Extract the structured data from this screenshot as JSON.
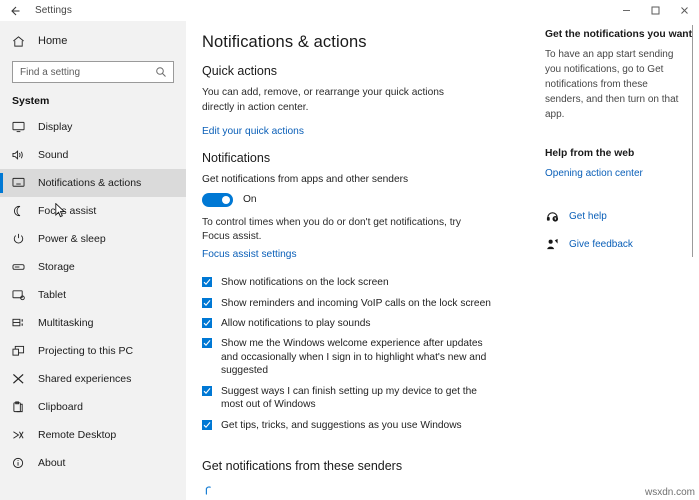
{
  "titlebar": {
    "back_label": "back-arrow",
    "title": "Settings",
    "minimize": "–",
    "maximize": "□",
    "close": "✕"
  },
  "sidebar": {
    "home_label": "Home",
    "search": {
      "placeholder": "Find a setting",
      "value": "",
      "icon": "search-icon"
    },
    "group_title": "System",
    "items": [
      {
        "label": "Display",
        "icon": "monitor-icon",
        "selected": false
      },
      {
        "label": "Sound",
        "icon": "speaker-icon",
        "selected": false
      },
      {
        "label": "Notifications & actions",
        "icon": "notification-icon",
        "selected": true
      },
      {
        "label": "Focus assist",
        "icon": "moon-icon",
        "selected": false
      },
      {
        "label": "Power & sleep",
        "icon": "power-icon",
        "selected": false
      },
      {
        "label": "Storage",
        "icon": "drive-icon",
        "selected": false
      },
      {
        "label": "Tablet",
        "icon": "tablet-icon",
        "selected": false
      },
      {
        "label": "Multitasking",
        "icon": "multitask-icon",
        "selected": false
      },
      {
        "label": "Projecting to this PC",
        "icon": "project-icon",
        "selected": false
      },
      {
        "label": "Shared experiences",
        "icon": "share-icon",
        "selected": false
      },
      {
        "label": "Clipboard",
        "icon": "clipboard-icon",
        "selected": false
      },
      {
        "label": "Remote Desktop",
        "icon": "remote-desktop-icon",
        "selected": false
      },
      {
        "label": "About",
        "icon": "info-icon",
        "selected": false
      }
    ]
  },
  "main": {
    "page_title": "Notifications & actions",
    "quick_actions": {
      "heading": "Quick actions",
      "description": "You can add, remove, or rearrange your quick actions directly in action center.",
      "link": "Edit your quick actions"
    },
    "notifications": {
      "heading": "Notifications",
      "toggle_label": "Get notifications from apps and other senders",
      "toggle_state": "On",
      "toggle_on": true,
      "note": "To control times when you do or don't get notifications, try Focus assist.",
      "note_link": "Focus assist settings",
      "options": [
        {
          "label": "Show notifications on the lock screen",
          "checked": true
        },
        {
          "label": "Show reminders and incoming VoIP calls on the lock screen",
          "checked": true
        },
        {
          "label": "Allow notifications to play sounds",
          "checked": true
        },
        {
          "label": "Show me the Windows welcome experience after updates and occasionally when I sign in to highlight what's new and suggested",
          "checked": true
        },
        {
          "label": "Suggest ways I can finish setting up my device to get the most out of Windows",
          "checked": true
        },
        {
          "label": "Get tips, tricks, and suggestions as you use Windows",
          "checked": true
        }
      ]
    },
    "senders": {
      "heading": "Get notifications from these senders",
      "loading": true
    }
  },
  "rail": {
    "heading1": "Get the notifications you want",
    "paragraph1": "To have an app start sending you notifications, go to Get notifications from these senders, and then turn on that app.",
    "heading2": "Help from the web",
    "link1": "Opening action center",
    "actions": [
      {
        "label": "Get help",
        "icon": "headset-icon"
      },
      {
        "label": "Give feedback",
        "icon": "feedback-icon"
      }
    ]
  },
  "colors": {
    "accent": "#0078d4",
    "link": "#0a5fb8",
    "sidebar_bg": "#f2f2f2",
    "selected_bg": "#dadada"
  },
  "watermark": "wsxdn.com"
}
